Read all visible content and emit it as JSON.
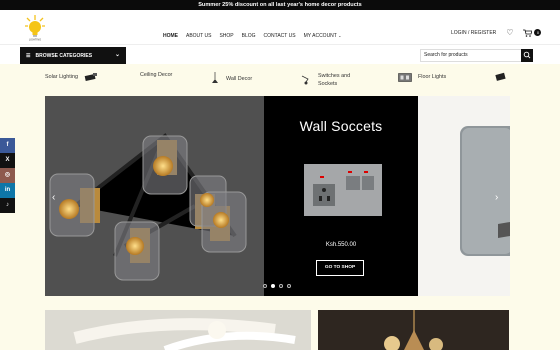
{
  "promo": {
    "text": "Summer 25% discount on all last year's home decor products"
  },
  "header": {
    "nav": [
      "HOME",
      "ABOUT US",
      "SHOP",
      "BLOG",
      "CONTACT US",
      "MY ACCOUNT"
    ],
    "login": "LOGIN / REGISTER",
    "cart_count": "0"
  },
  "catbar": {
    "browse_label": "BROWSE CATEGORIES",
    "search_placeholder": "Search for products"
  },
  "categories": [
    {
      "label": "Solar Lighting"
    },
    {
      "label": "Ceiling Decor"
    },
    {
      "label": "Wall Decor"
    },
    {
      "label": "Switches and\nSockets"
    },
    {
      "label": "Floor Lights"
    }
  ],
  "hero": {
    "product_title": "Wall Soccets",
    "price": "Ksh.550.00",
    "button": "GO TO SHOP",
    "dots_total": 4,
    "dots_active": 1
  },
  "social": [
    "f",
    "X",
    "◎",
    "in",
    "♪"
  ],
  "colors": {
    "topbar": "#0b0b0b",
    "accent": "#111111",
    "page_bg": "#fdfbea",
    "facebook": "#3b5998",
    "twitter": "#111111",
    "instagram": "#8e5a4e",
    "linkedin": "#0e76a8",
    "tiktok": "#111111"
  }
}
